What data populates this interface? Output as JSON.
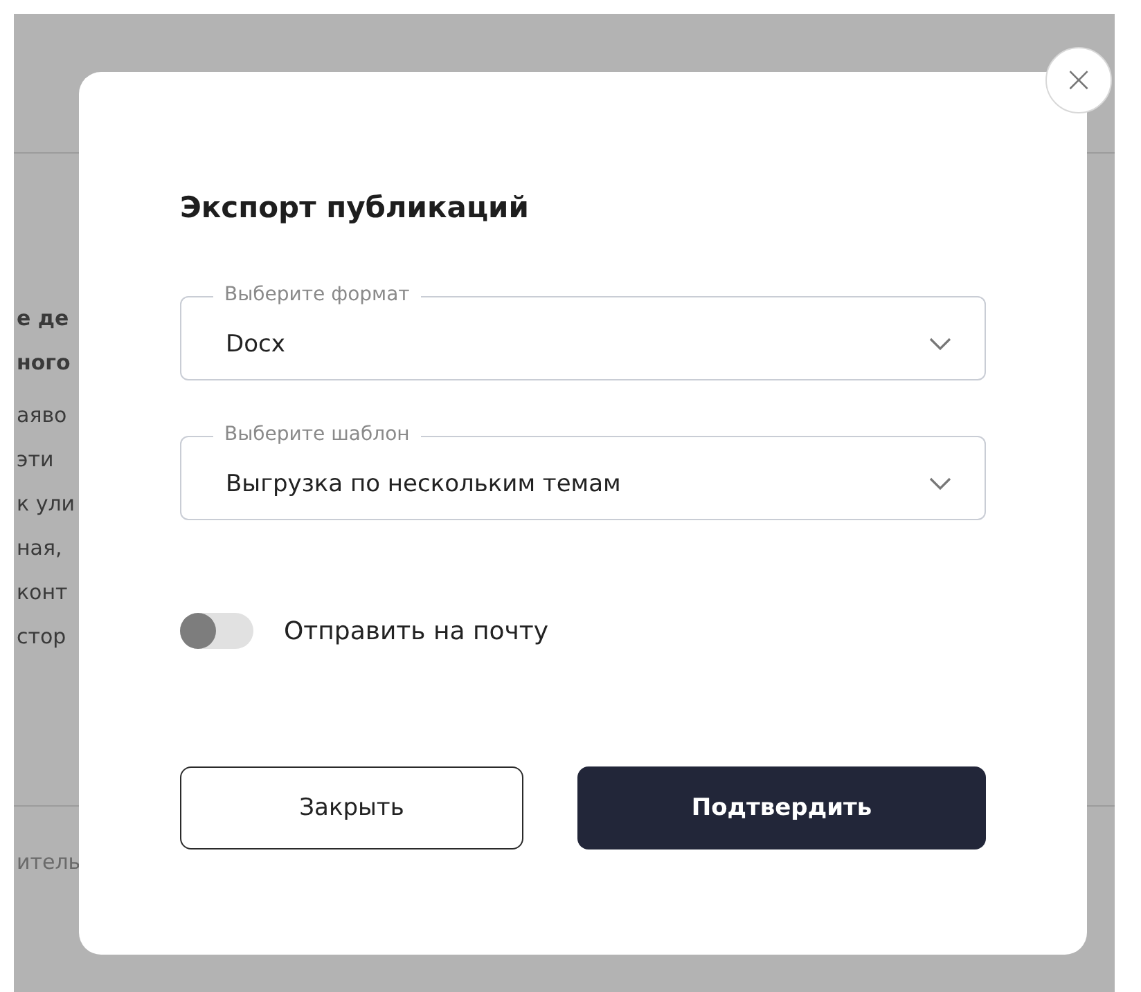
{
  "background": {
    "bold_lines": [
      "е де",
      "ного"
    ],
    "lines": [
      "аяво",
      "эти",
      "к ули",
      "ная,",
      "конт",
      "стор"
    ],
    "footer": "итель"
  },
  "dialog": {
    "title": "Экспорт публикаций",
    "close": "×",
    "fields": [
      {
        "label": "Выберите формат",
        "value": "Docx"
      },
      {
        "label": "Выберите шаблон",
        "value": "Выгрузка по нескольким темам"
      }
    ],
    "send_to_email": {
      "label": "Отправить на почту",
      "on": false
    },
    "buttons": [
      {
        "label": "Закрыть",
        "kind": "secondary"
      },
      {
        "label": "Подтвердить",
        "kind": "primary"
      }
    ]
  }
}
